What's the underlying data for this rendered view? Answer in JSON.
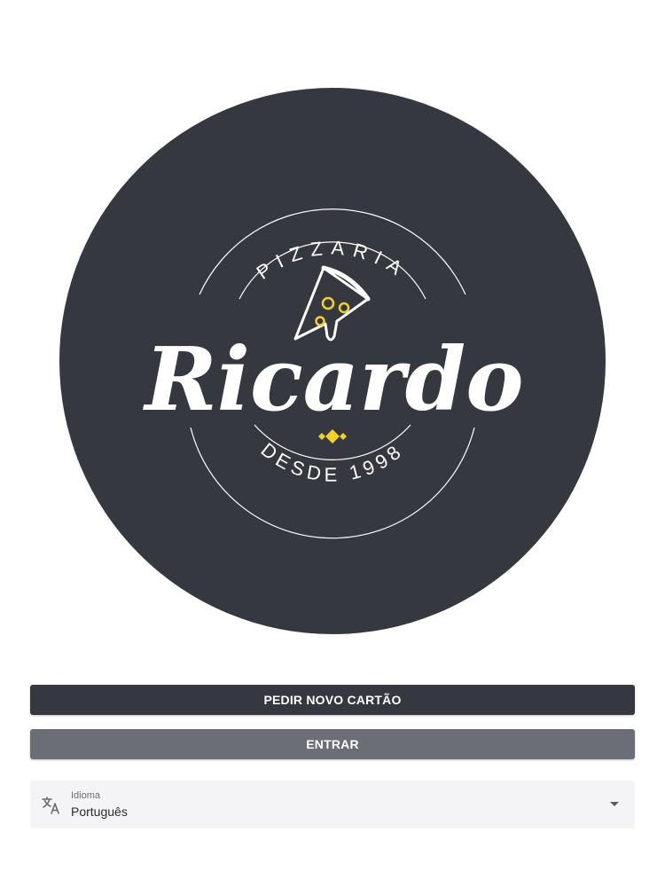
{
  "logo": {
    "top_text": "PIZZARIA",
    "name": "Ricardo",
    "bottom_text": "DESDE 1998",
    "background_color": "#35383f",
    "text_color": "#ffffff",
    "accent_color": "#f2d12c"
  },
  "actions": {
    "new_card_label": "PEDIR NOVO CARTÃO",
    "login_label": "ENTRAR"
  },
  "language": {
    "label": "Idioma",
    "value": "Português"
  }
}
